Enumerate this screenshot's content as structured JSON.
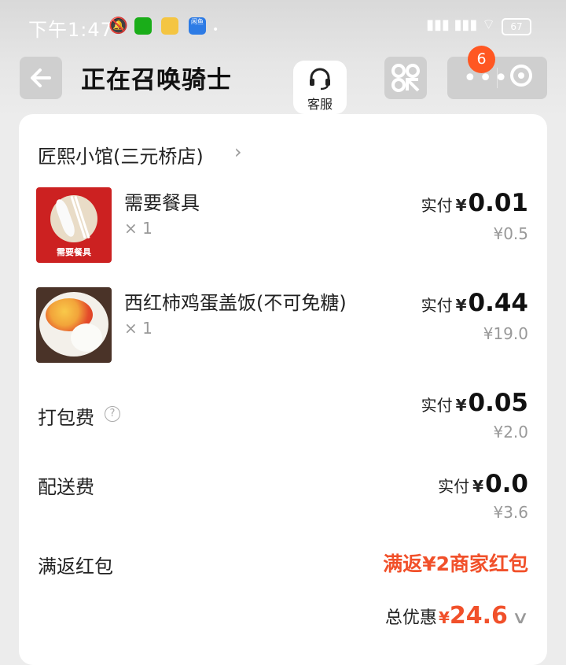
{
  "status_bar": {
    "time": "下午1:47",
    "battery": "67",
    "app_xianyu": "闲鱼"
  },
  "header": {
    "title": "正在召唤骑士",
    "customer_service_label": "客服",
    "notification_count": "6"
  },
  "order": {
    "shop_name": "匠熙小馆(三元桥店)",
    "pay_label": "实付",
    "currency": "¥",
    "items": [
      {
        "name": "需要餐具",
        "qty": "× 1",
        "paid": "0.01",
        "original": "¥0.5",
        "image_label": "需要餐具"
      },
      {
        "name": "西红柿鸡蛋盖饭(不可免糖)",
        "qty": "× 1",
        "paid": "0.44",
        "original": "¥19.0"
      }
    ],
    "fees": [
      {
        "label": "打包费",
        "paid": "0.05",
        "original": "¥2.0"
      },
      {
        "label": "配送费",
        "paid": "0.0",
        "original": "¥3.6"
      }
    ],
    "promo": {
      "label": "满返红包",
      "value": "满返¥2商家红包"
    },
    "total": {
      "label": "总优惠",
      "currency": "¥",
      "value": "24.6"
    }
  },
  "icons": [
    "back-arrow-icon",
    "headset-icon",
    "qr-scan-icon",
    "more-icon",
    "target-icon",
    "help-icon",
    "chevron-right-icon",
    "chevron-down-icon"
  ],
  "colors": {
    "accent": "#f1502a",
    "badge": "#ff5722"
  }
}
